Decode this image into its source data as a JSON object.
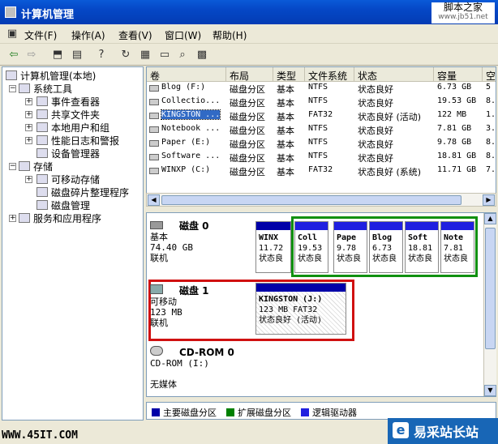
{
  "window": {
    "title": "计算机管理"
  },
  "watermark_top": {
    "line1": "脚本之家",
    "line2": "www.jb51.net"
  },
  "menu": [
    "文件(F)",
    "操作(A)",
    "查看(V)",
    "窗口(W)",
    "帮助(H)"
  ],
  "tree": {
    "root": "计算机管理(本地)",
    "system_tools": "系统工具",
    "event_viewer": "事件查看器",
    "shared_folders": "共享文件夹",
    "local_users": "本地用户和组",
    "perf_logs": "性能日志和警报",
    "device_manager": "设备管理器",
    "storage": "存储",
    "removable_storage": "可移动存储",
    "defrag": "磁盘碎片整理程序",
    "disk_mgmt": "磁盘管理",
    "services": "服务和应用程序"
  },
  "columns": [
    "卷",
    "布局",
    "类型",
    "文件系统",
    "状态",
    "容量",
    "空"
  ],
  "volumes": [
    {
      "name": "Blog (F:)",
      "layout": "磁盘分区",
      "type": "基本",
      "fs": "NTFS",
      "status": "状态良好",
      "capacity": "6.73 GB",
      "free": "5"
    },
    {
      "name": "Collectio...",
      "layout": "磁盘分区",
      "type": "基本",
      "fs": "NTFS",
      "status": "状态良好",
      "capacity": "19.53 GB",
      "free": "8."
    },
    {
      "name": "KINGSTON ...",
      "layout": "磁盘分区",
      "type": "基本",
      "fs": "FAT32",
      "status": "状态良好 (活动)",
      "capacity": "122 MB",
      "free": "1."
    },
    {
      "name": "Notebook ...",
      "layout": "磁盘分区",
      "type": "基本",
      "fs": "NTFS",
      "status": "状态良好",
      "capacity": "7.81 GB",
      "free": "3."
    },
    {
      "name": "Paper (E:)",
      "layout": "磁盘分区",
      "type": "基本",
      "fs": "NTFS",
      "status": "状态良好",
      "capacity": "9.78 GB",
      "free": "8."
    },
    {
      "name": "Software ...",
      "layout": "磁盘分区",
      "type": "基本",
      "fs": "NTFS",
      "status": "状态良好",
      "capacity": "18.81 GB",
      "free": "8."
    },
    {
      "name": "WINXP (C:)",
      "layout": "磁盘分区",
      "type": "基本",
      "fs": "FAT32",
      "status": "状态良好 (系统)",
      "capacity": "11.71 GB",
      "free": "7."
    }
  ],
  "disk0": {
    "title": "磁盘 0",
    "type": "基本",
    "size": "74.40 GB",
    "state": "联机",
    "parts": [
      {
        "l1": "WINX",
        "l2": "11.72",
        "l3": "状态良"
      },
      {
        "l1": "Coll",
        "l2": "19.53",
        "l3": "状态良"
      },
      {
        "l1": "Pape",
        "l2": "9.78",
        "l3": "状态良"
      },
      {
        "l1": "Blog",
        "l2": "6.73",
        "l3": "状态良"
      },
      {
        "l1": "Soft",
        "l2": "18.81",
        "l3": "状态良"
      },
      {
        "l1": "Note",
        "l2": "7.81",
        "l3": "状态良"
      }
    ]
  },
  "disk1": {
    "title": "磁盘 1",
    "type": "可移动",
    "size": "123 MB",
    "state": "联机",
    "part": {
      "l1": "KINGSTON (J:)",
      "l2": "123 MB FAT32",
      "l3": "状态良好 (活动)"
    }
  },
  "cdrom": {
    "title": "CD-ROM 0",
    "drive": "CD-ROM (I:)",
    "media": "无媒体"
  },
  "legend": {
    "primary": "主要磁盘分区",
    "extended": "扩展磁盘分区",
    "logical": "逻辑驱动器"
  },
  "colors": {
    "primary": "#0000a8",
    "extended": "#008000",
    "logical": "#2020e0",
    "highlight_red": "#d01010",
    "highlight_green": "#109010"
  },
  "watermark_bottom_left": "WWW.45IT.COM",
  "watermark_bottom_right": "易采站长站"
}
